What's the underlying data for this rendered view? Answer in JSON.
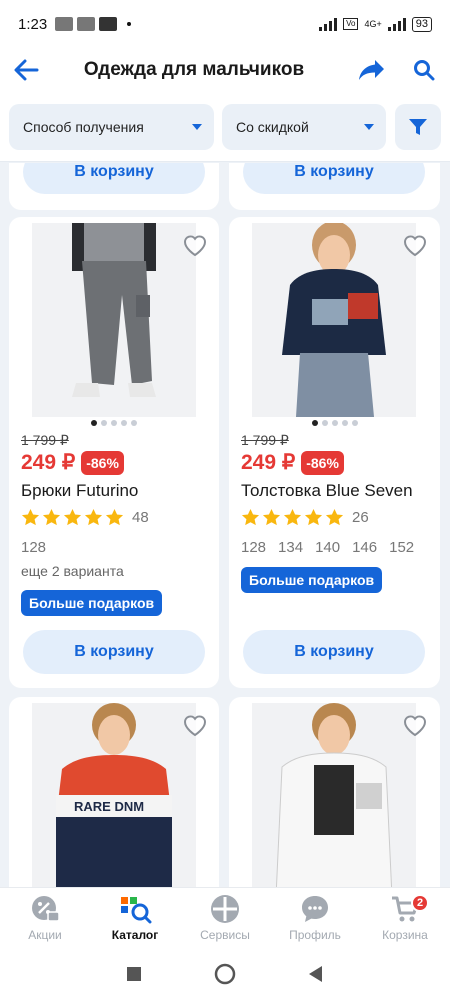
{
  "status_bar": {
    "time": "1:23",
    "battery": "93",
    "net": "4G+"
  },
  "header": {
    "title": "Одежда для мальчиков"
  },
  "filters": {
    "delivery_label": "Способ получения",
    "discount_label": "Со скидкой"
  },
  "top_cart_buttons": [
    "В корзину",
    "В корзину"
  ],
  "products": [
    {
      "old_price": "1 799 ₽",
      "price": "249 ₽",
      "discount": "-86%",
      "name": "Брюки Futurino",
      "rating_count": "48",
      "sizes": [
        "128"
      ],
      "variants": "еще 2 варианта",
      "gift": "Больше подарков",
      "cart": "В корзину"
    },
    {
      "old_price": "1 799 ₽",
      "price": "249 ₽",
      "discount": "-86%",
      "name": "Толстовка Blue Seven",
      "rating_count": "26",
      "sizes": [
        "128",
        "134",
        "140",
        "146",
        "152"
      ],
      "gift": "Больше подарков",
      "cart": "В корзину"
    },
    {
      "name": ""
    },
    {
      "name": ""
    }
  ],
  "bottom_nav": {
    "promos": "Акции",
    "catalog": "Каталог",
    "services": "Сервисы",
    "profile": "Профиль",
    "cart": "Корзина",
    "cart_badge": "2"
  },
  "colors": {
    "accent": "#1565d8",
    "price_red": "#e53935",
    "star": "#f9b70f",
    "bg": "#eef2f7"
  }
}
